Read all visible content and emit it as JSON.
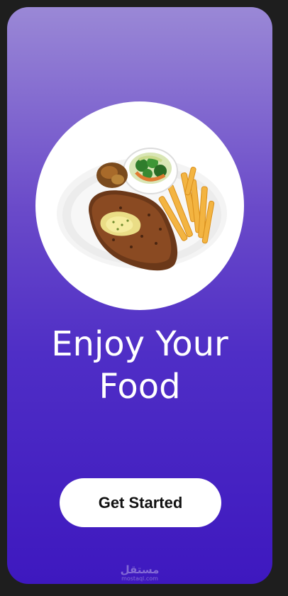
{
  "screen": {
    "headline_line1": "Enjoy Your",
    "headline_line2": "Food",
    "cta_label": "Get Started"
  },
  "hero_image": {
    "icon": "steak-plate-image",
    "alt": "Plate with steak, fries and salad"
  },
  "watermark": {
    "main": "مستقل",
    "sub": "mostaql.com"
  },
  "colors": {
    "gradient_top": "#9a88d6",
    "gradient_bottom": "#3e18bf",
    "button_bg": "#ffffff",
    "text": "#ffffff",
    "outer_bg": "#1e1e1e"
  }
}
